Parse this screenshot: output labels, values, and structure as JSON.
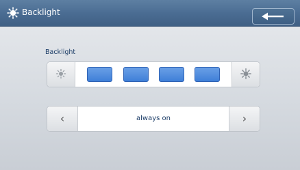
{
  "header": {
    "title": "Backlight",
    "icon": "sun-icon",
    "back_icon": "back-arrow-icon"
  },
  "backlight": {
    "label": "Backlight",
    "decrease_icon": "dim-sun-icon",
    "increase_icon": "bright-sun-icon",
    "level": 4,
    "max_level": 4,
    "level_color": "#4a86dc"
  },
  "mode": {
    "value": "always on",
    "prev_icon": "chevron-left-icon",
    "next_icon": "chevron-right-icon"
  },
  "colors": {
    "header": "#4b6d93",
    "label_text": "#1a3b66"
  }
}
